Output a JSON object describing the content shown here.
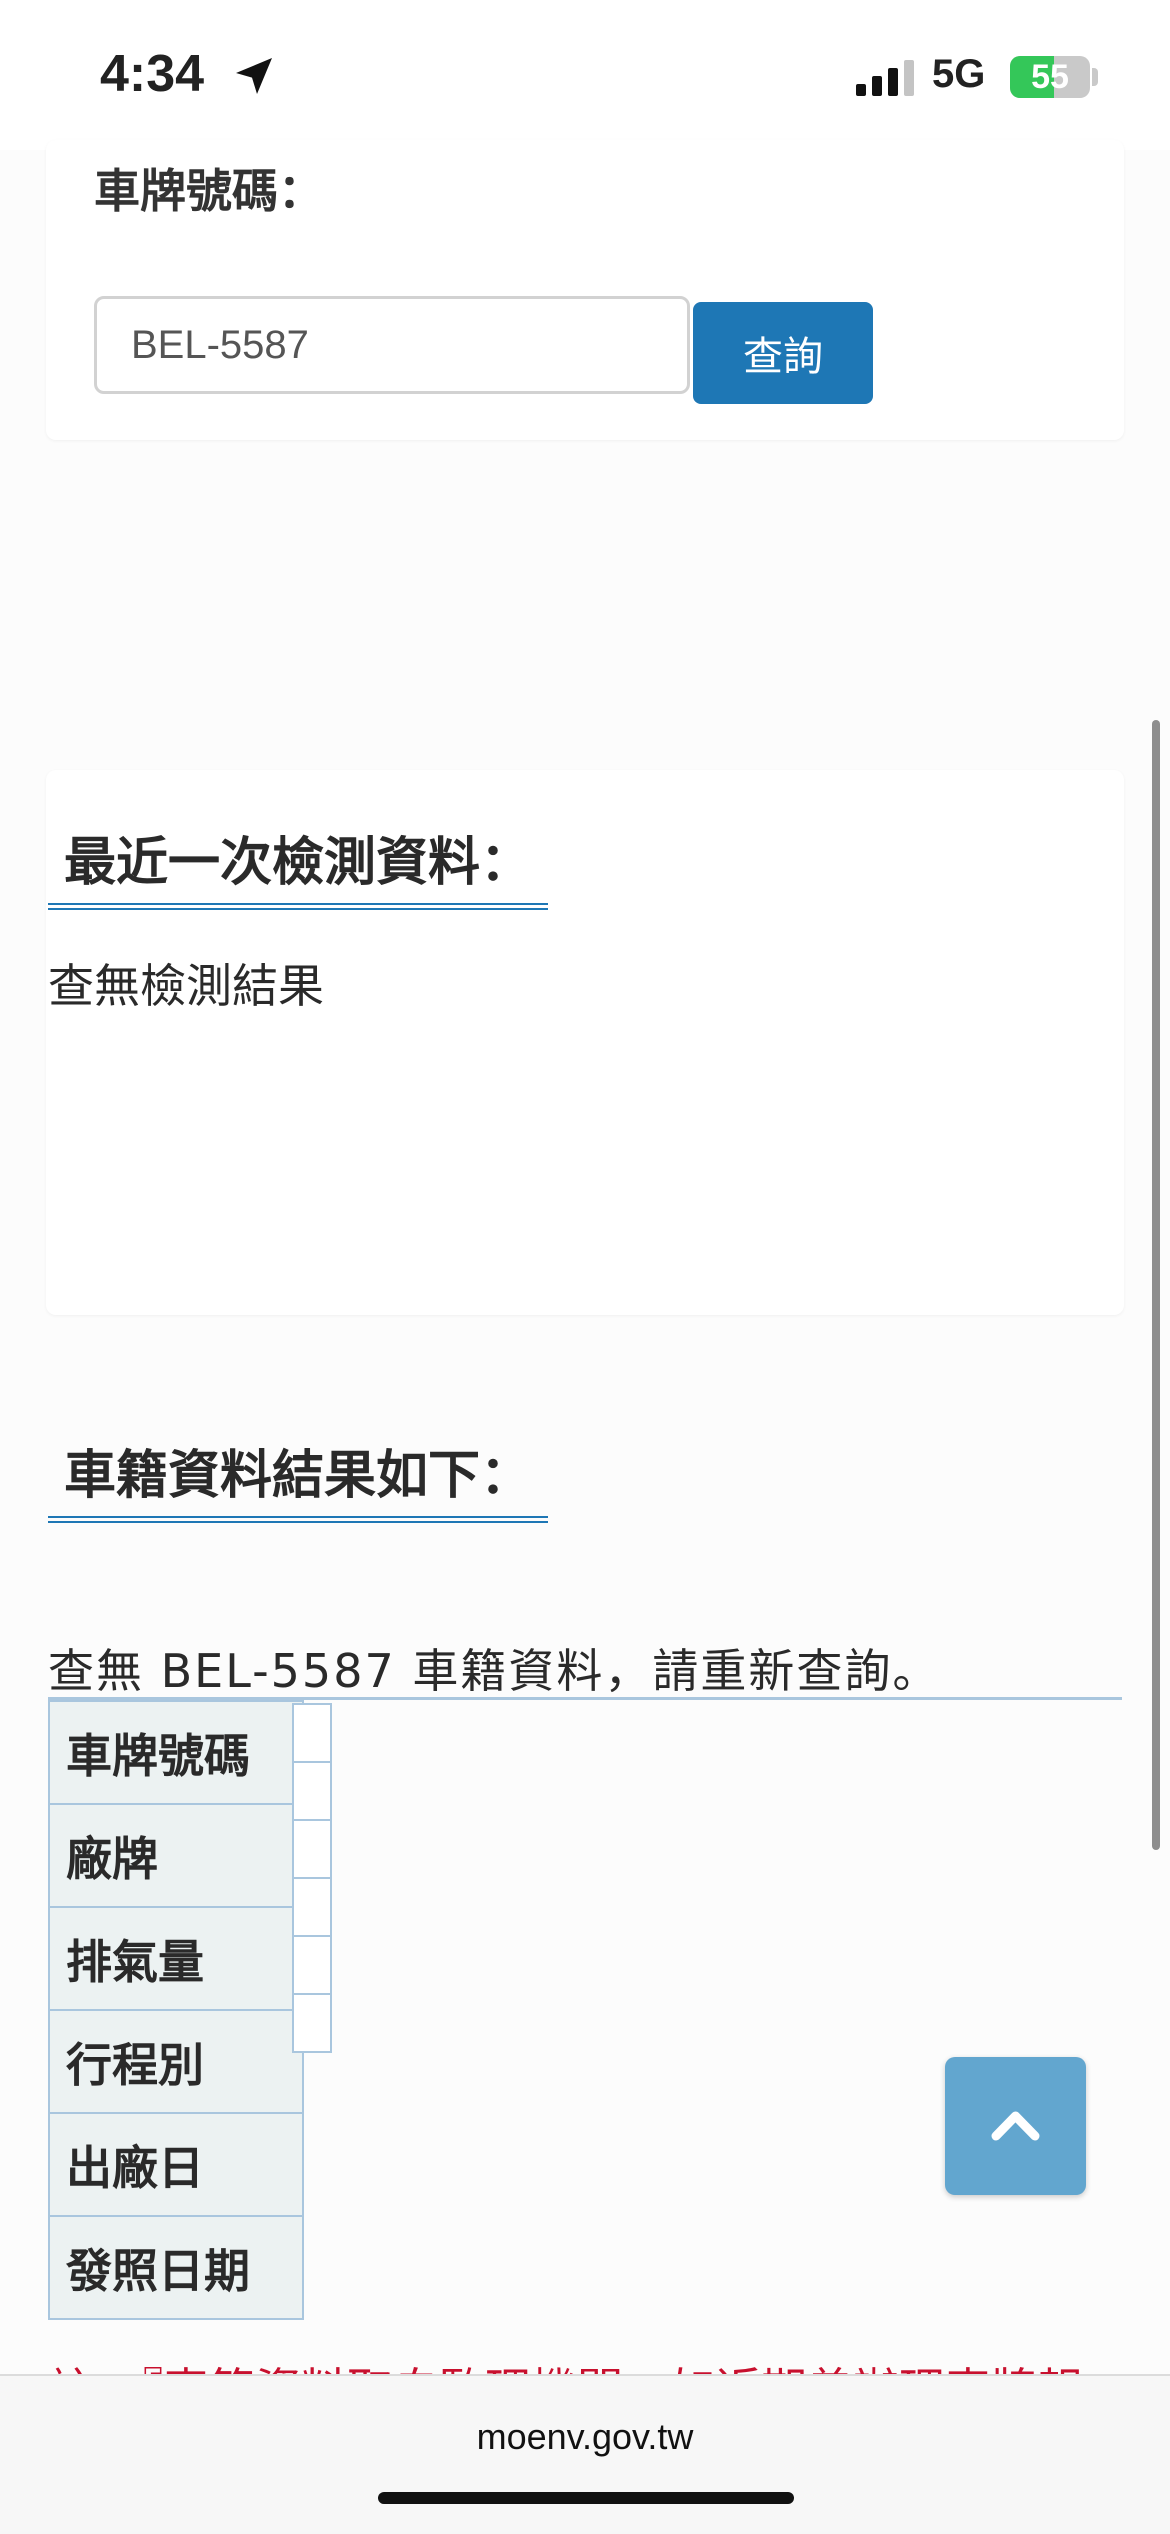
{
  "status_bar": {
    "time": "4:34",
    "network": "5G",
    "battery": "55",
    "battery_level": 0.55
  },
  "search": {
    "label": "車牌號碼：",
    "value": "BEL-5587",
    "button": "查詢"
  },
  "latest_inspection": {
    "title": "最近一次檢測資料：",
    "message": "查無檢測結果"
  },
  "registration": {
    "title": "車籍資料結果如下：",
    "message": "查無 BEL-5587 車籍資料，請重新查詢。",
    "rows": [
      "車牌號碼",
      "廠牌",
      "排氣量",
      "行程別",
      "出廠日",
      "發照日期"
    ]
  },
  "note": "註：『車籍資料取自監理機關，如近期曾辦理車牌報",
  "browser": {
    "domain": "moenv.gov.tw"
  },
  "colors": {
    "accent": "#1e77b5",
    "note_red": "#c8102e",
    "table_border": "#a9c6de"
  }
}
